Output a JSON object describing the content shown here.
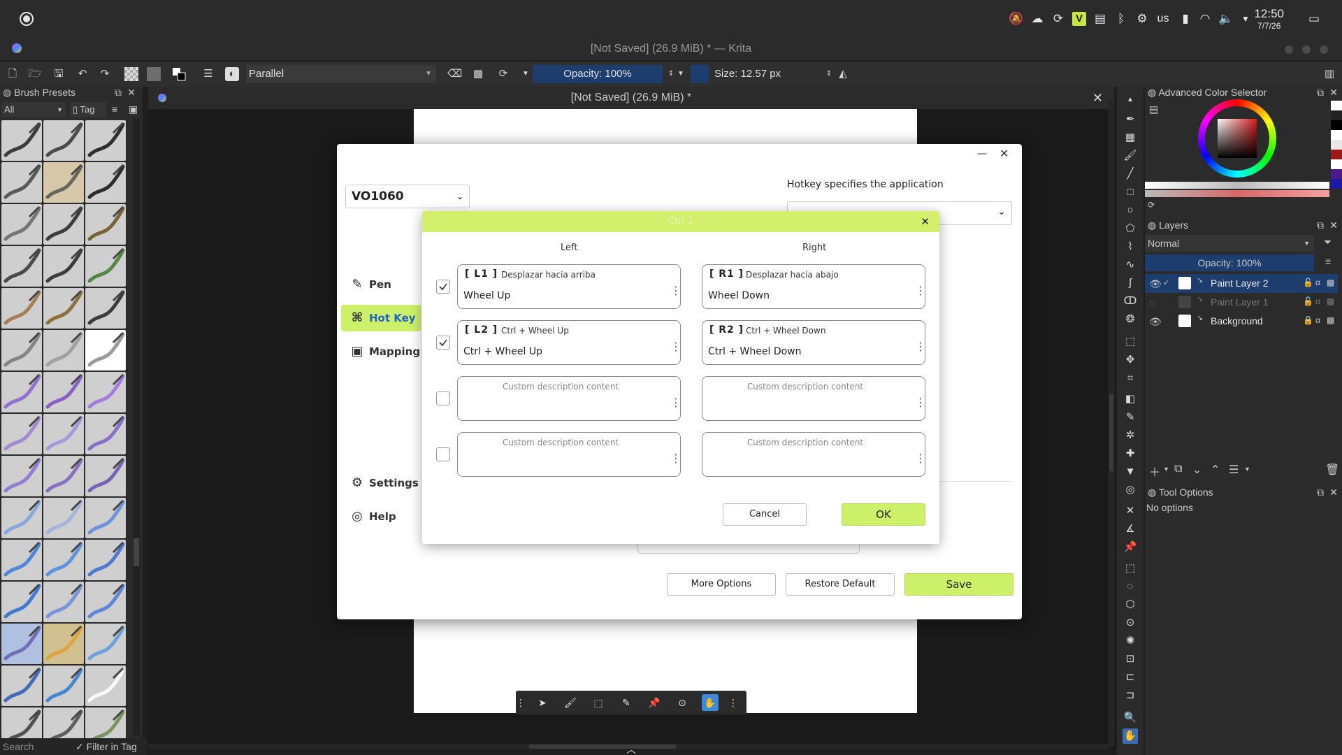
{
  "system_bar": {
    "keyboard_layout": "us",
    "time": "12:50",
    "date": "7/7/26",
    "icons": [
      "notifications-off-icon",
      "steam-icon",
      "sync-icon",
      "vim-icon",
      "clipboard-icon",
      "bluetooth-icon",
      "gear-icon",
      "battery-icon",
      "wifi-icon",
      "volume-icon",
      "menu-icon",
      "desktop-icon"
    ]
  },
  "window": {
    "title": "[Not Saved] (26.9 MiB) * — Krita"
  },
  "toolbar": {
    "blend_mode": "Parallel",
    "opacity": "Opacity: 100%",
    "size": "Size: 12.57 px"
  },
  "brush_presets": {
    "title": "Brush Presets",
    "filter": "All",
    "tag": "Tag",
    "search_placeholder": "Search",
    "filter_in_tag": "Filter in Tag"
  },
  "document": {
    "tab_title": "[Not Saved]  (26.9 MiB) *"
  },
  "color_selector": {
    "title": "Advanced Color Selector"
  },
  "layers": {
    "title": "Layers",
    "blend_mode": "Normal",
    "opacity": "Opacity: 100%",
    "items": [
      {
        "name": "Paint Layer 2",
        "visible": true,
        "active": true
      },
      {
        "name": "Paint Layer 1",
        "visible": false,
        "active": false
      },
      {
        "name": "Background",
        "visible": true,
        "active": false
      }
    ]
  },
  "tool_options": {
    "title": "Tool Options",
    "text": "No options"
  },
  "settings_app": {
    "device": "VO1060",
    "hotkey_label": "Hotkey specifies the application",
    "nav": [
      {
        "label": "Pen"
      },
      {
        "label": "Hot Key"
      },
      {
        "label": "Mapping"
      },
      {
        "label": "Settings"
      },
      {
        "label": "Help"
      }
    ],
    "buttons": {
      "more_options": "More Options",
      "restore_default": "Restore Default",
      "save": "Save"
    }
  },
  "hotkey_dialog": {
    "title": "Ctrl 1",
    "left_label": "Left",
    "right_label": "Right",
    "rows": [
      {
        "checked": true,
        "left": {
          "tag": "[ L1 ]",
          "desc": "Desplazar hacia arriba",
          "value": "Wheel Up"
        },
        "right": {
          "tag": "[ R1 ]",
          "desc": "Desplazar hacia abajo",
          "value": "Wheel Down"
        }
      },
      {
        "checked": true,
        "left": {
          "tag": "[ L2 ]",
          "desc": "Ctrl + Wheel Up",
          "value": "Ctrl + Wheel Up"
        },
        "right": {
          "tag": "[ R2 ]",
          "desc": "Ctrl + Wheel Down",
          "value": "Ctrl + Wheel Down"
        }
      },
      {
        "checked": false,
        "left": {
          "placeholder": "Custom description content"
        },
        "right": {
          "placeholder": "Custom description content"
        }
      },
      {
        "checked": false,
        "left": {
          "placeholder": "Custom description content"
        },
        "right": {
          "placeholder": "Custom description content"
        }
      }
    ],
    "cancel": "Cancel",
    "ok": "OK"
  },
  "colors": {
    "accent_green": "#cdf06a",
    "header_green": "#d3ef6b",
    "krita_selection": "#1c3d6e"
  }
}
